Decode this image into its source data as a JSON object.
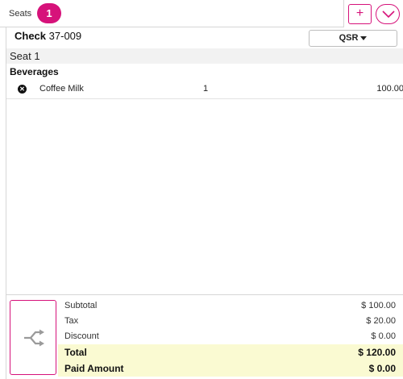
{
  "seats": {
    "label": "Seats",
    "active_seat": "1",
    "add_label": "+"
  },
  "check": {
    "prefix": "Check",
    "number": "37-009",
    "mode": "QSR"
  },
  "order": {
    "seat_label": "Seat 1",
    "category": "Beverages",
    "items": [
      {
        "name": "Coffee Milk",
        "qty": "1",
        "price": "100.00"
      }
    ]
  },
  "totals": {
    "subtotal_label": "Subtotal",
    "subtotal": "$ 100.00",
    "tax_label": "Tax",
    "tax": "$ 20.00",
    "discount_label": "Discount",
    "discount": "$ 0.00",
    "total_label": "Total",
    "total": "$ 120.00",
    "paid_label": "Paid Amount",
    "paid": "$ 0.00"
  },
  "colors": {
    "accent": "#d6127a",
    "highlight": "#fafad2"
  },
  "icons": {
    "remove": "close-circle-icon",
    "split": "split-arrows-icon",
    "expand": "chevron-down-icon"
  }
}
